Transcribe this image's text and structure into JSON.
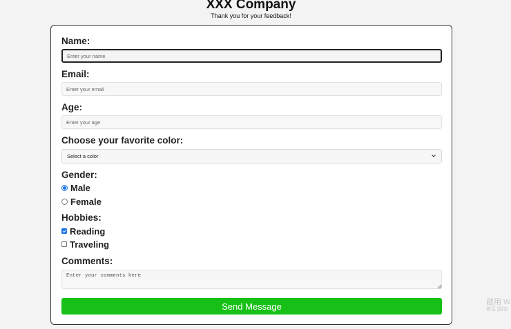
{
  "header": {
    "company": "XXX Company",
    "tagline": "Thank you for your feedback!"
  },
  "form": {
    "name": {
      "label": "Name:",
      "placeholder": "Enter your name",
      "value": ""
    },
    "email": {
      "label": "Email:",
      "placeholder": "Enter your email",
      "value": ""
    },
    "age": {
      "label": "Age:",
      "placeholder": "Enter your age",
      "value": ""
    },
    "color": {
      "label": "Choose your favorite color:",
      "selected": "Select a color"
    },
    "gender": {
      "label": "Gender:",
      "options": [
        {
          "label": "Male",
          "checked": true
        },
        {
          "label": "Female",
          "checked": false
        }
      ]
    },
    "hobbies": {
      "label": "Hobbies:",
      "options": [
        {
          "label": "Reading",
          "checked": true
        },
        {
          "label": "Traveling",
          "checked": false
        }
      ]
    },
    "comments": {
      "label": "Comments:",
      "placeholder": "Enter your comments here",
      "value": ""
    },
    "submit_label": "Send Message"
  },
  "watermark": {
    "line1": "啟用 Wi",
    "line2": "移至 [設定"
  },
  "colors": {
    "submit_bg": "#17c017",
    "accent": "#1a73e8",
    "card_border": "#333333"
  }
}
